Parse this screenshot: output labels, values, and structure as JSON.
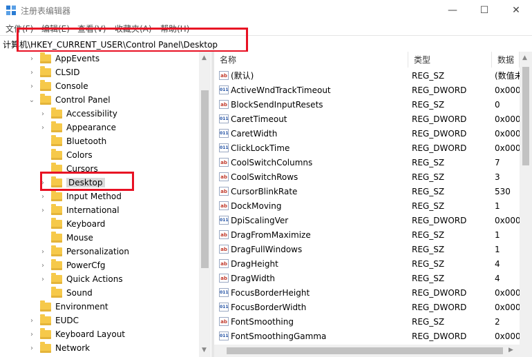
{
  "window": {
    "title": "注册表编辑器",
    "minimize_glyph": "—",
    "maximize_glyph": "☐",
    "close_glyph": "✕"
  },
  "menu": [
    "文件(F)",
    "编辑(E)",
    "查看(V)",
    "收藏夹(A)",
    "帮助(H)"
  ],
  "address": {
    "path": "计算机\\HKEY_CURRENT_USER\\Control Panel\\Desktop"
  },
  "tree": [
    {
      "label": "AppEvents",
      "chevron": "›"
    },
    {
      "label": "CLSID",
      "chevron": "›"
    },
    {
      "label": "Console",
      "chevron": "›"
    },
    {
      "label": "Control Panel",
      "chevron": "⌄"
    },
    {
      "label": "Accessibility",
      "chevron": "›"
    },
    {
      "label": "Appearance",
      "chevron": "›"
    },
    {
      "label": "Bluetooth",
      "chevron": ""
    },
    {
      "label": "Colors",
      "chevron": ""
    },
    {
      "label": "Cursors",
      "chevron": ""
    },
    {
      "label": "Desktop",
      "chevron": "›"
    },
    {
      "label": "Input Method",
      "chevron": "›"
    },
    {
      "label": "International",
      "chevron": "›"
    },
    {
      "label": "Keyboard",
      "chevron": ""
    },
    {
      "label": "Mouse",
      "chevron": ""
    },
    {
      "label": "Personalization",
      "chevron": "›"
    },
    {
      "label": "PowerCfg",
      "chevron": "›"
    },
    {
      "label": "Quick Actions",
      "chevron": "›"
    },
    {
      "label": "Sound",
      "chevron": ""
    },
    {
      "label": "Environment",
      "chevron": ""
    },
    {
      "label": "EUDC",
      "chevron": "›"
    },
    {
      "label": "Keyboard Layout",
      "chevron": "›"
    },
    {
      "label": "Network",
      "chevron": "›"
    }
  ],
  "columns": {
    "name": "名称",
    "type": "类型",
    "data": "数据"
  },
  "values": [
    {
      "name": "(默认)",
      "type": "REG_SZ",
      "data": "(数值未",
      "icon": "ab"
    },
    {
      "name": "ActiveWndTrackTimeout",
      "type": "REG_DWORD",
      "data": "0x000",
      "icon": "011"
    },
    {
      "name": "BlockSendInputResets",
      "type": "REG_SZ",
      "data": "0",
      "icon": "ab"
    },
    {
      "name": "CaretTimeout",
      "type": "REG_DWORD",
      "data": "0x000",
      "icon": "011"
    },
    {
      "name": "CaretWidth",
      "type": "REG_DWORD",
      "data": "0x000",
      "icon": "011"
    },
    {
      "name": "ClickLockTime",
      "type": "REG_DWORD",
      "data": "0x000",
      "icon": "011"
    },
    {
      "name": "CoolSwitchColumns",
      "type": "REG_SZ",
      "data": "7",
      "icon": "ab"
    },
    {
      "name": "CoolSwitchRows",
      "type": "REG_SZ",
      "data": "3",
      "icon": "ab"
    },
    {
      "name": "CursorBlinkRate",
      "type": "REG_SZ",
      "data": "530",
      "icon": "ab"
    },
    {
      "name": "DockMoving",
      "type": "REG_SZ",
      "data": "1",
      "icon": "ab"
    },
    {
      "name": "DpiScalingVer",
      "type": "REG_DWORD",
      "data": "0x000",
      "icon": "011"
    },
    {
      "name": "DragFromMaximize",
      "type": "REG_SZ",
      "data": "1",
      "icon": "ab"
    },
    {
      "name": "DragFullWindows",
      "type": "REG_SZ",
      "data": "1",
      "icon": "ab"
    },
    {
      "name": "DragHeight",
      "type": "REG_SZ",
      "data": "4",
      "icon": "ab"
    },
    {
      "name": "DragWidth",
      "type": "REG_SZ",
      "data": "4",
      "icon": "ab"
    },
    {
      "name": "FocusBorderHeight",
      "type": "REG_DWORD",
      "data": "0x000",
      "icon": "011"
    },
    {
      "name": "FocusBorderWidth",
      "type": "REG_DWORD",
      "data": "0x000",
      "icon": "011"
    },
    {
      "name": "FontSmoothing",
      "type": "REG_SZ",
      "data": "2",
      "icon": "ab"
    },
    {
      "name": "FontSmoothingGamma",
      "type": "REG_DWORD",
      "data": "0x000",
      "icon": "011"
    }
  ],
  "colors": {
    "highlight": "#e81123",
    "folder": "#f6c94a",
    "selected_bg": "#d9d9d9"
  }
}
